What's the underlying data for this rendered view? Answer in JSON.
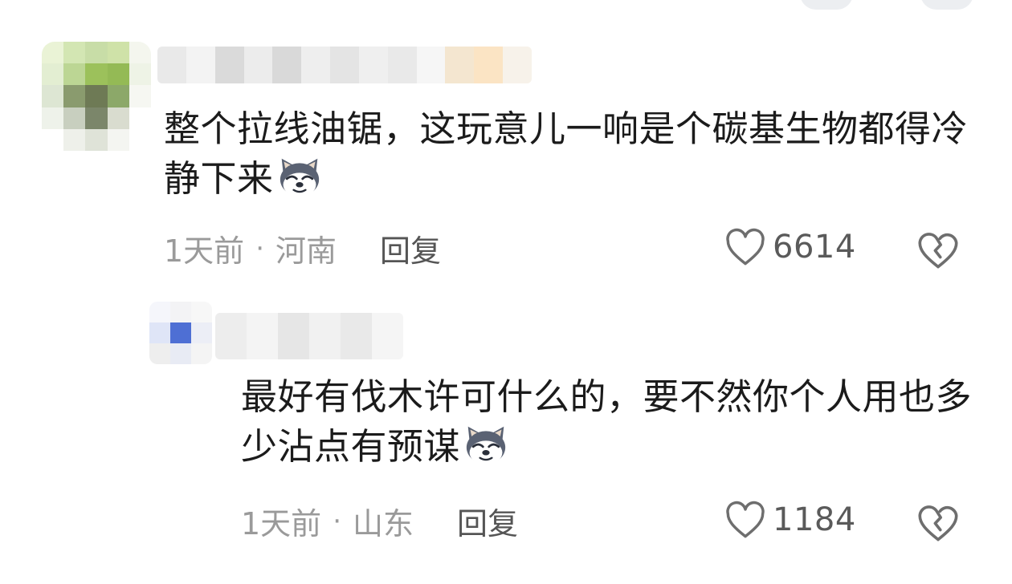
{
  "comments": [
    {
      "text": "整个拉线油锯，这玩意儿一响是个碳基生物都得冷静下来",
      "emoji": "dog-face-emoji",
      "time": "1天前",
      "separator": "·",
      "location": "河南",
      "reply_label": "回复",
      "likes": "6614",
      "avatar_colors": [
        "#eaf3d6",
        "#d3e6b3",
        "#c8dda7",
        "#cfe2a8",
        "#f4f6ee",
        "#e3eed2",
        "#bcd694",
        "#9cc15b",
        "#94ba55",
        "#eef3e6",
        "#dde6d3",
        "#8a9b6e",
        "#6e7a55",
        "#8ca869",
        "#f6f7f2",
        "#eef2ea",
        "#c8cfbf",
        "#7b866a",
        "#d9dccf",
        "#ffffff",
        "#ffffff",
        "#eef0ea",
        "#dfe3d8",
        "#f4f5f1",
        "#ffffff"
      ],
      "name_colors": [
        "#e9e9e9",
        "#f3f3f3",
        "#dadada",
        "#ececec",
        "#d9d9d9",
        "#eeeeee",
        "#e4e4e4",
        "#efefef",
        "#e9e9e9",
        "#f6f6f6",
        "#f4e6d0",
        "#fbe4c4",
        "#f7f2ea"
      ]
    },
    {
      "text": "最好有伐木许可什么的，要不然你个人用也多少沾点有预谋",
      "emoji": "dog-face-emoji",
      "time": "1天前",
      "separator": "·",
      "location": "山东",
      "reply_label": "回复",
      "likes": "1184",
      "avatar_colors": [
        "#f5f6fb",
        "#f3f3f5",
        "#f7f7f7",
        "#dfe5f7",
        "#4e6fd4",
        "#eceef6",
        "#eeeeee",
        "#e8ebf4",
        "#f4f4f4"
      ],
      "name_colors": [
        "#ededed",
        "#f4f4f4",
        "#e6e6e6",
        "#f1f1f1",
        "#e9e9e9",
        "#f5f5f5"
      ]
    }
  ]
}
